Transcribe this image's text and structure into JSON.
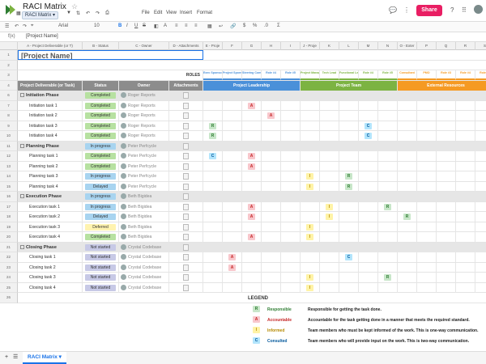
{
  "app": {
    "title": "RACI Matrix",
    "view_label": "RACI Matrix",
    "share_label": "Share"
  },
  "menu": [
    "File",
    "Edit",
    "View",
    "Insert",
    "Format"
  ],
  "toolbar": {
    "font": "Arial",
    "size": "10"
  },
  "formula": {
    "fx": "f(x)",
    "value": "[Project Name]"
  },
  "columns": [
    "A - Project Deliverable (or T)",
    "B - Status",
    "C - Owner",
    "D - Attachments",
    "E - Proje",
    "F",
    "G",
    "H",
    "I",
    "J - Proje",
    "K",
    "L",
    "M",
    "N",
    "O - Exter",
    "P",
    "Q",
    "R",
    "S"
  ],
  "project_name": "[Project Name]",
  "roles_label": "ROLES",
  "header": {
    "deliverable": "Project Deliverable (or Task)",
    "status": "Status",
    "owner": "Owner",
    "attachments": "Attachments"
  },
  "groups": [
    {
      "label": "Project Leadership",
      "color": "#4a90d9"
    },
    {
      "label": "Project Team",
      "color": "#7cb342"
    },
    {
      "label": "External Resources",
      "color": "#f59a23"
    }
  ],
  "roles": [
    "Exec Sponsor",
    "Project Sponsor",
    "Steering Committee",
    "Role #4",
    "Role #5",
    "Project Manager",
    "Tech Lead",
    "Functional Lead",
    "Role #4",
    "Role #5",
    "Consultant",
    "PMO",
    "Role #3",
    "Role #4",
    "Role #5"
  ],
  "rows": [
    {
      "n": "6",
      "type": "phase",
      "name": "Initiation Phase",
      "status": "Completed",
      "owner": "Roger Reports"
    },
    {
      "n": "7",
      "name": "Initiation task 1",
      "status": "Completed",
      "owner": "Roger Reports",
      "raci": {
        "2": "A"
      }
    },
    {
      "n": "8",
      "name": "Initiation task 2",
      "status": "Completed",
      "owner": "Roger Reports",
      "raci": {
        "3": "A"
      }
    },
    {
      "n": "9",
      "name": "Initiation task 3",
      "status": "Completed",
      "owner": "Roger Reports",
      "raci": {
        "0": "R",
        "8": "C"
      }
    },
    {
      "n": "10",
      "name": "Initiation task 4",
      "status": "Completed",
      "owner": "Roger Reports",
      "raci": {
        "0": "R",
        "8": "C"
      }
    },
    {
      "n": "11",
      "type": "phase",
      "name": "Planning Phase",
      "status": "In progress",
      "owner": "Peter Perfcycle"
    },
    {
      "n": "12",
      "name": "Planning task 1",
      "status": "Completed",
      "owner": "Peter Perfcycle",
      "raci": {
        "0": "C",
        "2": "A"
      }
    },
    {
      "n": "13",
      "name": "Planning task 2",
      "status": "Completed",
      "owner": "Peter Perfcycle",
      "raci": {
        "2": "A"
      }
    },
    {
      "n": "14",
      "name": "Planning task 3",
      "status": "In progress",
      "owner": "Peter Perfcycle",
      "raci": {
        "5": "I",
        "7": "R"
      }
    },
    {
      "n": "15",
      "name": "Planning task 4",
      "status": "Delayed",
      "owner": "Peter Perfcycle",
      "raci": {
        "5": "I",
        "7": "R"
      }
    },
    {
      "n": "16",
      "type": "phase",
      "name": "Execution Phase",
      "status": "In progress",
      "owner": "Beth Bigidea"
    },
    {
      "n": "17",
      "name": "Execution task 1",
      "status": "In progress",
      "owner": "Beth Bigidea",
      "raci": {
        "2": "A",
        "6": "I",
        "9": "R"
      }
    },
    {
      "n": "18",
      "name": "Execution task 2",
      "status": "Delayed",
      "owner": "Beth Bigidea",
      "raci": {
        "2": "A",
        "6": "I",
        "10": "R"
      }
    },
    {
      "n": "19",
      "name": "Execution task 3",
      "status": "Deferred",
      "owner": "Beth Bigidea",
      "raci": {
        "5": "I"
      }
    },
    {
      "n": "20",
      "name": "Execution task 4",
      "status": "Completed",
      "owner": "Beth Bigidea",
      "raci": {
        "2": "A",
        "5": "I"
      }
    },
    {
      "n": "21",
      "type": "phase",
      "name": "Closing Phase",
      "status": "Not started",
      "owner": "Crystal Codebase"
    },
    {
      "n": "22",
      "name": "Closing task 1",
      "status": "Not started",
      "owner": "Crystal Codebase",
      "raci": {
        "1": "A",
        "7": "C"
      }
    },
    {
      "n": "23",
      "name": "Closing task 2",
      "status": "Not started",
      "owner": "Crystal Codebase",
      "raci": {
        "1": "A"
      }
    },
    {
      "n": "24",
      "name": "Closing task 3",
      "status": "Not started",
      "owner": "Crystal Codebase",
      "raci": {
        "5": "I",
        "9": "R"
      }
    },
    {
      "n": "25",
      "name": "Closing task 4",
      "status": "Not started",
      "owner": "Crystal Codebase",
      "raci": {
        "5": "I"
      }
    }
  ],
  "status_colors": {
    "Completed": "#b7e1a1",
    "In progress": "#a8d4f0",
    "Delayed": "#a8d4f0",
    "Deferred": "#fff3b0",
    "Not started": "#c7c9e6"
  },
  "raci_colors": {
    "R": {
      "bg": "#c8e6c9",
      "fg": "#2e7d32"
    },
    "A": {
      "bg": "#f8c7cc",
      "fg": "#c62828"
    },
    "I": {
      "bg": "#fff3a6",
      "fg": "#b58900"
    },
    "C": {
      "bg": "#b3e5fc",
      "fg": "#01579b"
    }
  },
  "legend": {
    "title": "LEGEND",
    "items": [
      {
        "letter": "R",
        "name": "Responsible",
        "desc": "Responsible for getting the task done."
      },
      {
        "letter": "A",
        "name": "Accountable",
        "desc": "Accountable for the task getting done in a manner that meets the required standard."
      },
      {
        "letter": "I",
        "name": "Informed",
        "desc": "Team members who must be kept informed of the work. This is one-way communication."
      },
      {
        "letter": "C",
        "name": "Consulted",
        "desc": "Team members who will provide input on the work. This is two-way communication."
      }
    ]
  },
  "sheet_tab": "RACI Matrix"
}
